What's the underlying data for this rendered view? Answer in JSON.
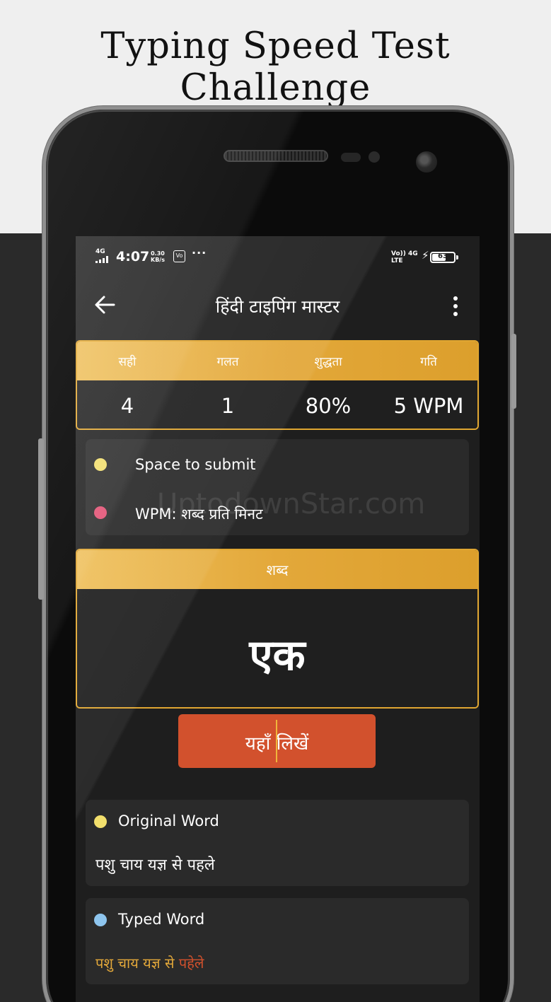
{
  "promo": {
    "title": "Typing Speed Test Challenge"
  },
  "status_bar": {
    "network_type": "4G",
    "time": "4:07",
    "speed_value": "0.30",
    "speed_unit": "KB/s",
    "vo_label": "Vo",
    "more": "···",
    "volte": "Vo)) LTE",
    "data_type": "4G",
    "battery": "63",
    "battery_level": 0.63
  },
  "app_bar": {
    "title": "हिंदी टाइपिंग मास्टर",
    "back_icon": "arrow-left-icon",
    "menu_icon": "more-vertical-icon"
  },
  "stats": {
    "labels": [
      "सही",
      "गलत",
      "शुद्धता",
      "गति"
    ],
    "values": [
      "4",
      "1",
      "80%",
      "5 WPM"
    ]
  },
  "legend": {
    "items": [
      {
        "label": "Space to submit",
        "color": "#f2df6c"
      },
      {
        "label": "WPM: शब्द प्रति मिनट",
        "color": "#e35073"
      }
    ]
  },
  "watermark": "UptodownStar.com",
  "word_card": {
    "header": "शब्द",
    "word": "एक"
  },
  "input": {
    "placeholder": "यहाँ लिखें"
  },
  "original": {
    "label": "Original Word",
    "text": "पशु चाय यज्ञ से पहले",
    "dot_color": "#f2df6c"
  },
  "typed": {
    "label": "Typed  Word",
    "dot_color": "#8ec5ee",
    "words": [
      {
        "text": "पशु ",
        "color": "#e3a83a"
      },
      {
        "text": "चाय ",
        "color": "#e3a83a"
      },
      {
        "text": "यज्ञ ",
        "color": "#e3a83a"
      },
      {
        "text": "से ",
        "color": "#e3a83a"
      },
      {
        "text": "पहेले",
        "color": "#d2512d"
      }
    ]
  },
  "colors": {
    "accent_gold": "#e0a631",
    "input_orange": "#d2512d",
    "card_bg": "#2a2a2a",
    "screen_bg": "#1e1e1e"
  }
}
